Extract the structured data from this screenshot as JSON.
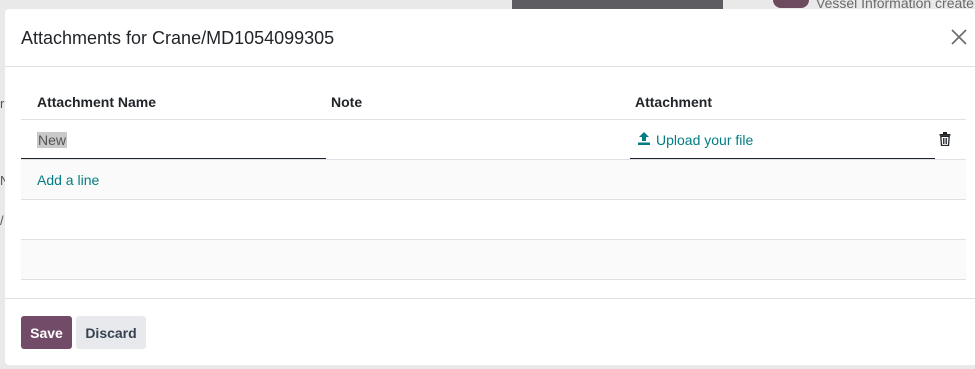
{
  "background": {
    "chatter_text": "Vessel Information create",
    "left_fragments": [
      "r",
      "N",
      "/"
    ]
  },
  "dialog": {
    "title": "Attachments for Crane/MD1054099305",
    "close_icon": "close-icon"
  },
  "table": {
    "columns": [
      "Attachment Name",
      "Note",
      "Attachment"
    ],
    "rows": [
      {
        "name": "New",
        "note": "",
        "attachment_label": "Upload your file"
      }
    ],
    "add_line": "Add a line"
  },
  "footer": {
    "save_label": "Save",
    "discard_label": "Discard"
  },
  "colors": {
    "primary": "#714b67",
    "link": "#017e84",
    "secondary": "#e7e9ed"
  }
}
